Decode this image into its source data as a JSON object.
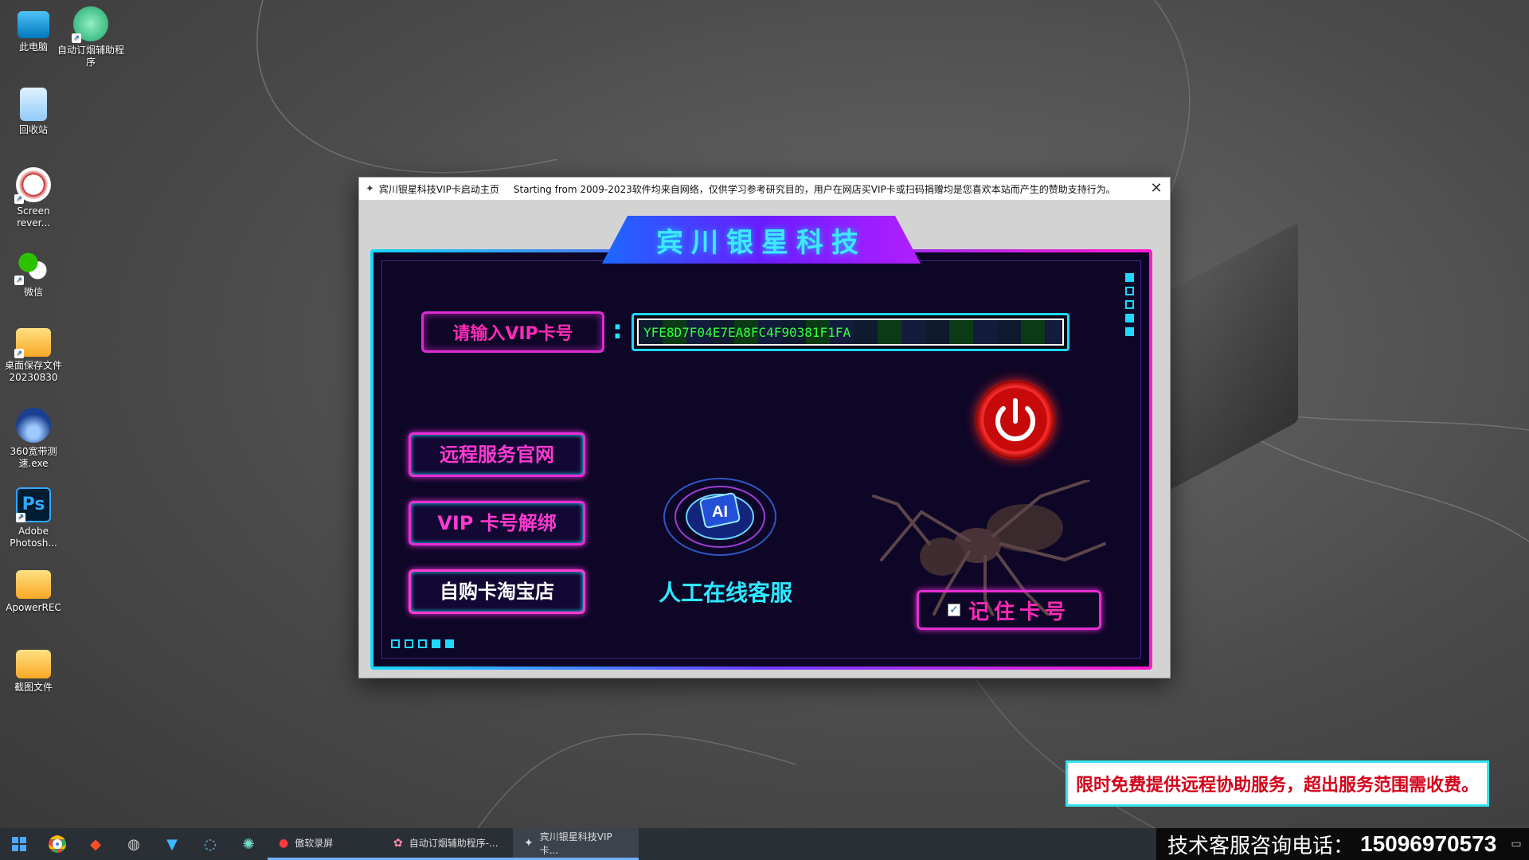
{
  "desktop": {
    "icons": [
      {
        "label": "此电脑",
        "icon": "computer-icon"
      },
      {
        "label": "自动订烟辅助程序",
        "icon": "cigarette-helper-icon"
      },
      {
        "label": "回收站",
        "icon": "recycle-bin-icon"
      },
      {
        "label": "Screen rever...",
        "icon": "cow-icon"
      },
      {
        "label": "微信",
        "icon": "wechat-icon"
      },
      {
        "label": "桌面保存文件20230830",
        "icon": "folder-icon"
      },
      {
        "label": "360宽带测速.exe",
        "icon": "speedometer-icon"
      },
      {
        "label": "Adobe Photosh...",
        "icon": "photoshop-icon"
      },
      {
        "label": "ApowerREC",
        "icon": "folder-icon"
      },
      {
        "label": "截图文件",
        "icon": "folder-icon"
      }
    ]
  },
  "window": {
    "title": "宾川银星科技VIP卡启动主页",
    "notice": "Starting from 2009-2023软件均来自网络，仅供学习参考研究目的，用户在网店买VIP卡或扫码捐赠均是您喜欢本站而产生的赞助支持行为。",
    "close": "✕"
  },
  "app": {
    "banner": "宾川银星科技",
    "vip_label": "请输入VIP卡号",
    "colon": ":",
    "vip_value": "YFE8D7F04E7EA8FC4F90381F1FA",
    "buttons": {
      "remote": "远程服务官网",
      "unbind": "VIP 卡号解绑",
      "shop": "自购卡淘宝店"
    },
    "ai_text": "AI",
    "service": "人工在线客服",
    "remember": "记住卡号",
    "remember_checked": "✓"
  },
  "promo": "限时免费提供远程协助服务，超出服务范围需收费。",
  "taskbar": {
    "apps": [
      {
        "label": "傲软录屏",
        "icon": "record-icon"
      },
      {
        "label": "自动订烟辅助程序-...",
        "icon": "cigarette-helper-icon"
      },
      {
        "label": "宾川银星科技VIP卡...",
        "icon": "vip-app-icon"
      }
    ],
    "hotline_label": "技术客服咨询电话：",
    "hotline_number": "15096970573"
  },
  "colors": {
    "accent_cyan": "#20e0ff",
    "accent_pink": "#ff2ab6",
    "panel_bg": "#0e0627",
    "promo_text": "#d4001a"
  }
}
